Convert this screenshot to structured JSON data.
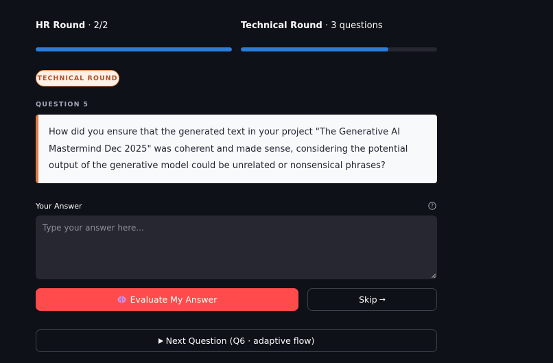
{
  "progress": {
    "hr": {
      "title": "HR Round",
      "detail": " · 2/2",
      "fraction": 1.0
    },
    "technical": {
      "title": "Technical Round",
      "detail": " · 3 questions",
      "fraction": 0.75
    },
    "fill_color": "#2b7ddb"
  },
  "badge": {
    "label": "TECHNICAL ROUND"
  },
  "question": {
    "number_label": "QUESTION 5",
    "text": "How did you ensure that the generated text in your project \"The Generative AI Mastermind Dec 2025\" was coherent and made sense, considering the potential output of the generative model could be unrelated or nonsensical phrases?"
  },
  "answer": {
    "label": "Your Answer",
    "placeholder": "Type your answer here...",
    "value": "",
    "help_icon": "question-circle-icon"
  },
  "actions": {
    "evaluate_label": "Evaluate My Answer",
    "evaluate_icon": "brain-icon",
    "skip_label": "Skip",
    "skip_icon": "arrow-right-icon",
    "next_label": "Next Question (Q6 · adaptive flow)",
    "next_icon": "play-icon"
  },
  "colors": {
    "primary": "#ff4b4b",
    "badge_border": "#e8894f",
    "question_accent": "#e07a3f"
  }
}
